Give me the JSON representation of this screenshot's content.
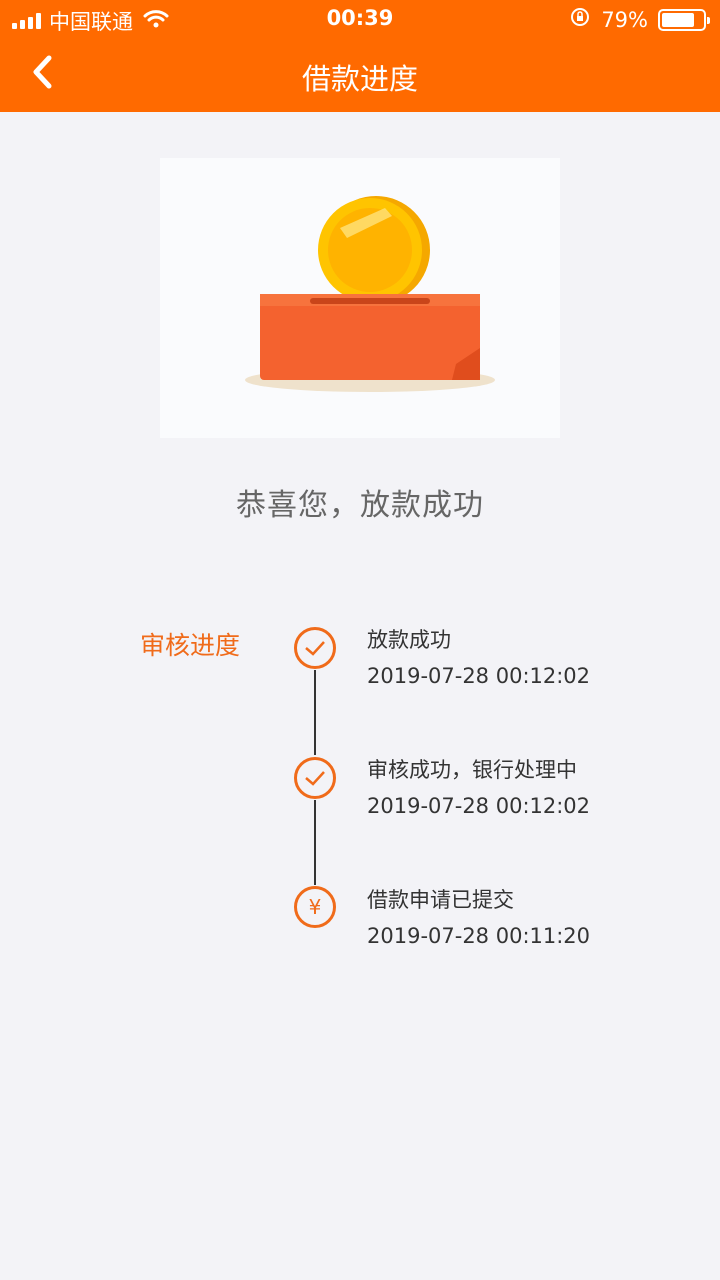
{
  "status_bar": {
    "carrier": "中国联通",
    "time": "00:39",
    "battery": "79%",
    "battery_level": 0.79
  },
  "nav": {
    "title": "借款进度"
  },
  "result": {
    "message": "恭喜您，放款成功"
  },
  "progress": {
    "label": "审核进度",
    "steps": [
      {
        "title": "放款成功",
        "time": "2019-07-28 00:12:02",
        "icon": "check-icon"
      },
      {
        "title": "审核成功，银行处理中",
        "time": "2019-07-28 00:12:02",
        "icon": "check-icon"
      },
      {
        "title": "借款申请已提交",
        "time": "2019-07-28 00:11:20",
        "icon": "yen-icon",
        "glyph": "¥"
      }
    ]
  },
  "colors": {
    "brand": "#ff6a00",
    "accent": "#f06b1a",
    "background": "#f3f3f7"
  }
}
